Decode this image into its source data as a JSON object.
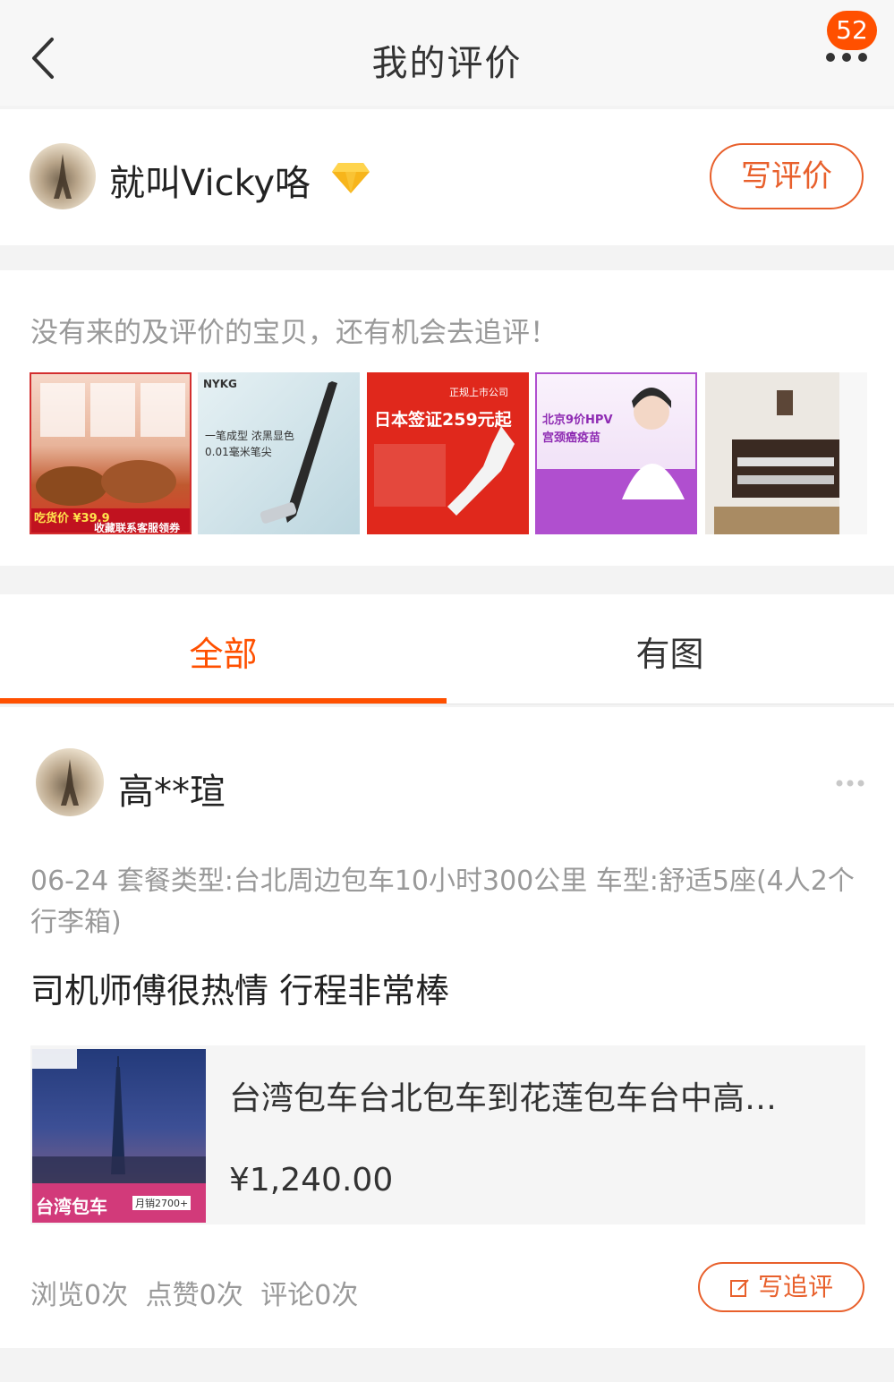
{
  "header": {
    "title": "我的评价",
    "notification_count": "52"
  },
  "user": {
    "name": "就叫Vicky咯",
    "write_review_label": "写评价"
  },
  "pending": {
    "hint": "没有来的及评价的宝贝，还有机会去追评！",
    "items": [
      {
        "caption": "吃货价 ¥39.9",
        "sub": "收藏联系客服领券",
        "color": "#c62828"
      },
      {
        "caption": "一笔成型 浓黑显色",
        "sub": "0.01毫米笔尖",
        "brand": "NYKG",
        "color": "#cfe3ea"
      },
      {
        "caption": "日本签证259元起",
        "sub": "正规上市公司",
        "color": "#e0281c"
      },
      {
        "caption": "北京9价HPV",
        "sub": "宫颈癌疫苗",
        "color": "#b04fcf"
      },
      {
        "caption": "",
        "sub": "",
        "color": "#e9e4de"
      }
    ]
  },
  "tabs": {
    "all": "全部",
    "with_images": "有图"
  },
  "review": {
    "reviewer": "高**瑄",
    "meta": "06-24 套餐类型:台北周边包车10小时300公里 车型:舒适5座(4人2个行李箱)",
    "text": "司机师傅很热情 行程非常棒",
    "product_title": "台湾包车台北包车到花莲包车台中高…",
    "product_price": "¥1,240.00",
    "product_img_label": "台湾包车",
    "product_img_sub": "月销2700+",
    "stats": "浏览0次  点赞0次  评论0次",
    "followup_label": "写追评"
  },
  "colors": {
    "accent": "#ff5000",
    "button_border": "#e8602c"
  }
}
